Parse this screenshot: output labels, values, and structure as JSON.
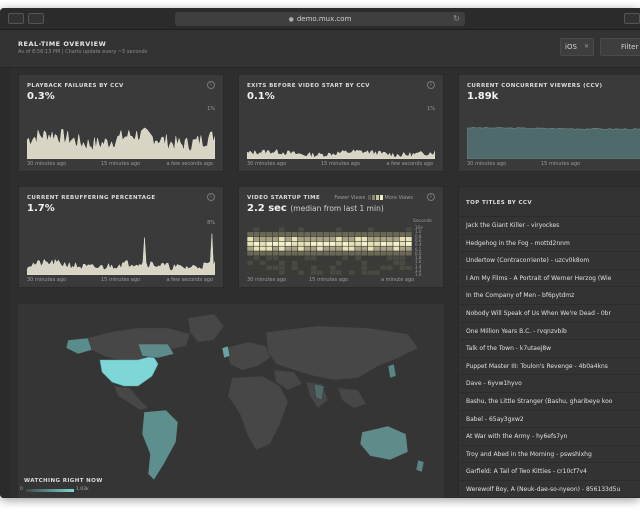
{
  "browser": {
    "url": "demo.mux.com"
  },
  "header": {
    "title": "REAL-TIME OVERVIEW",
    "subtitle": "As of 8:56:13 PM | Charts update every ~5 seconds",
    "platform_filter": "iOS",
    "filter_label": "Filter"
  },
  "panels": {
    "playback_failures": {
      "title": "PLAYBACK FAILURES BY CCV",
      "value": "0.3%",
      "y_max_label": "1%",
      "x_labels": [
        "30 minutes ago",
        "15 minutes ago",
        "a few seconds ago"
      ]
    },
    "exits_before_start": {
      "title": "EXITS BEFORE VIDEO START BY CCV",
      "value": "0.1%",
      "y_max_label": "1%",
      "x_labels": [
        "30 minutes ago",
        "15 minutes ago",
        "a few seconds ago"
      ]
    },
    "concurrent_viewers": {
      "title": "CURRENT CONCURRENT VIEWERS (CCV)",
      "value": "1.89k",
      "x_labels": [
        "30 minutes ago",
        "15 minutes ago"
      ]
    },
    "rebuffering": {
      "title": "CURRENT REBUFFERING PERCENTAGE",
      "value": "1.7%",
      "y_max_label": "8%",
      "x_labels": [
        "30 minutes ago",
        "15 minutes ago",
        "a few seconds ago"
      ]
    },
    "startup_time": {
      "title": "VIDEO STARTUP TIME",
      "value": "2.2 sec",
      "value_note": "(median from last 1 min)",
      "legend_fewer": "Fewer Views",
      "legend_more": "More Views",
      "y_axis_title": "Seconds",
      "y_labels": [
        "10+",
        "1.0",
        "0.8",
        "0.6",
        "0.4",
        "0.2",
        "0.0",
        "1.8",
        "1.6",
        "1.4",
        "1.2",
        "1.0"
      ],
      "x_labels": [
        "30 minutes ago",
        "15 minutes ago",
        "a minute ago"
      ]
    },
    "top_titles": {
      "title": "TOP TITLES BY CCV",
      "items": [
        "Jack the Giant Killer - viryockes",
        "Hedgehog in the Fog - mottd2nnm",
        "Undertow (Contracorriente) - uzcv0k8om",
        "I Am My Films - A Portrait of Werner Herzog (Wie",
        "In the Company of Men - bf6pytdmz",
        "Nobody Will Speak of Us When We're Dead - 0br",
        "One Million Years B.C. - rvqnzvbib",
        "Talk of the Town - k7utaej8w",
        "Puppet Master III: Toulon's Revenge - 4b0a4kns",
        "Dave - 6yvw1hyvo",
        "Bashu, the Little Stranger (Bashu, gharibeye koo",
        "Babel - 65ay3gxw2",
        "At War with the Army - hy6efs7yn",
        "Troy and Abed in the Morning - pswshlxhg",
        "Garfield: A Tail of Two Kitties - cr10cf7v4",
        "Werewolf Boy, A (Neuk-dae-so-nyeon) - 856133d5u"
      ]
    },
    "map": {
      "legend_title": "WATCHING RIGHT NOW",
      "legend_min": "0",
      "legend_max": "1.03k"
    }
  },
  "colors": {
    "line_fill": "#d8d5c4",
    "ccv_fill": "#4f6a6a",
    "map_high": "#7fd6d6",
    "map_base": "#474747"
  }
}
